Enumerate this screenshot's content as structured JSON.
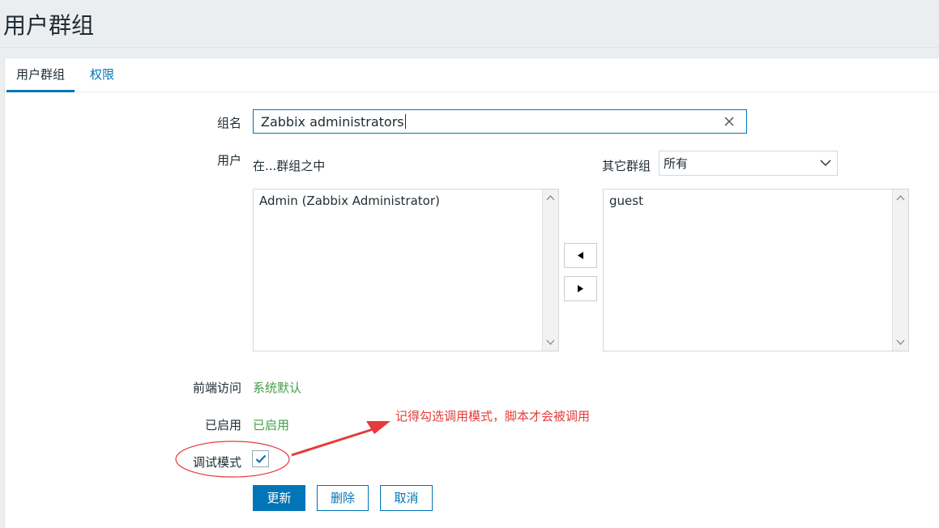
{
  "header": {
    "title": "用户群组"
  },
  "tabs": [
    {
      "label": "用户群组",
      "active": true
    },
    {
      "label": "权限",
      "active": false
    }
  ],
  "form": {
    "group_name": {
      "label": "组名",
      "value": "Zabbix administrators"
    },
    "users": {
      "label": "用户",
      "in_group_label": "在...群组之中",
      "in_group_items": [
        "Admin (Zabbix Administrator)"
      ],
      "other_groups_label": "其它群组",
      "other_groups_select": "所有",
      "other_items": [
        "guest"
      ]
    },
    "frontend_access": {
      "label": "前端访问",
      "value": "系统默认"
    },
    "enabled": {
      "label": "已启用",
      "value": "已启用"
    },
    "debug_mode": {
      "label": "调试模式",
      "checked": true
    }
  },
  "buttons": {
    "update": "更新",
    "delete": "删除",
    "cancel": "取消"
  },
  "annotation": {
    "text": "记得勾选调用模式，脚本才会被调用",
    "color": "#e53b3b"
  },
  "colors": {
    "accent": "#0275b8",
    "status_green": "#429e47"
  }
}
